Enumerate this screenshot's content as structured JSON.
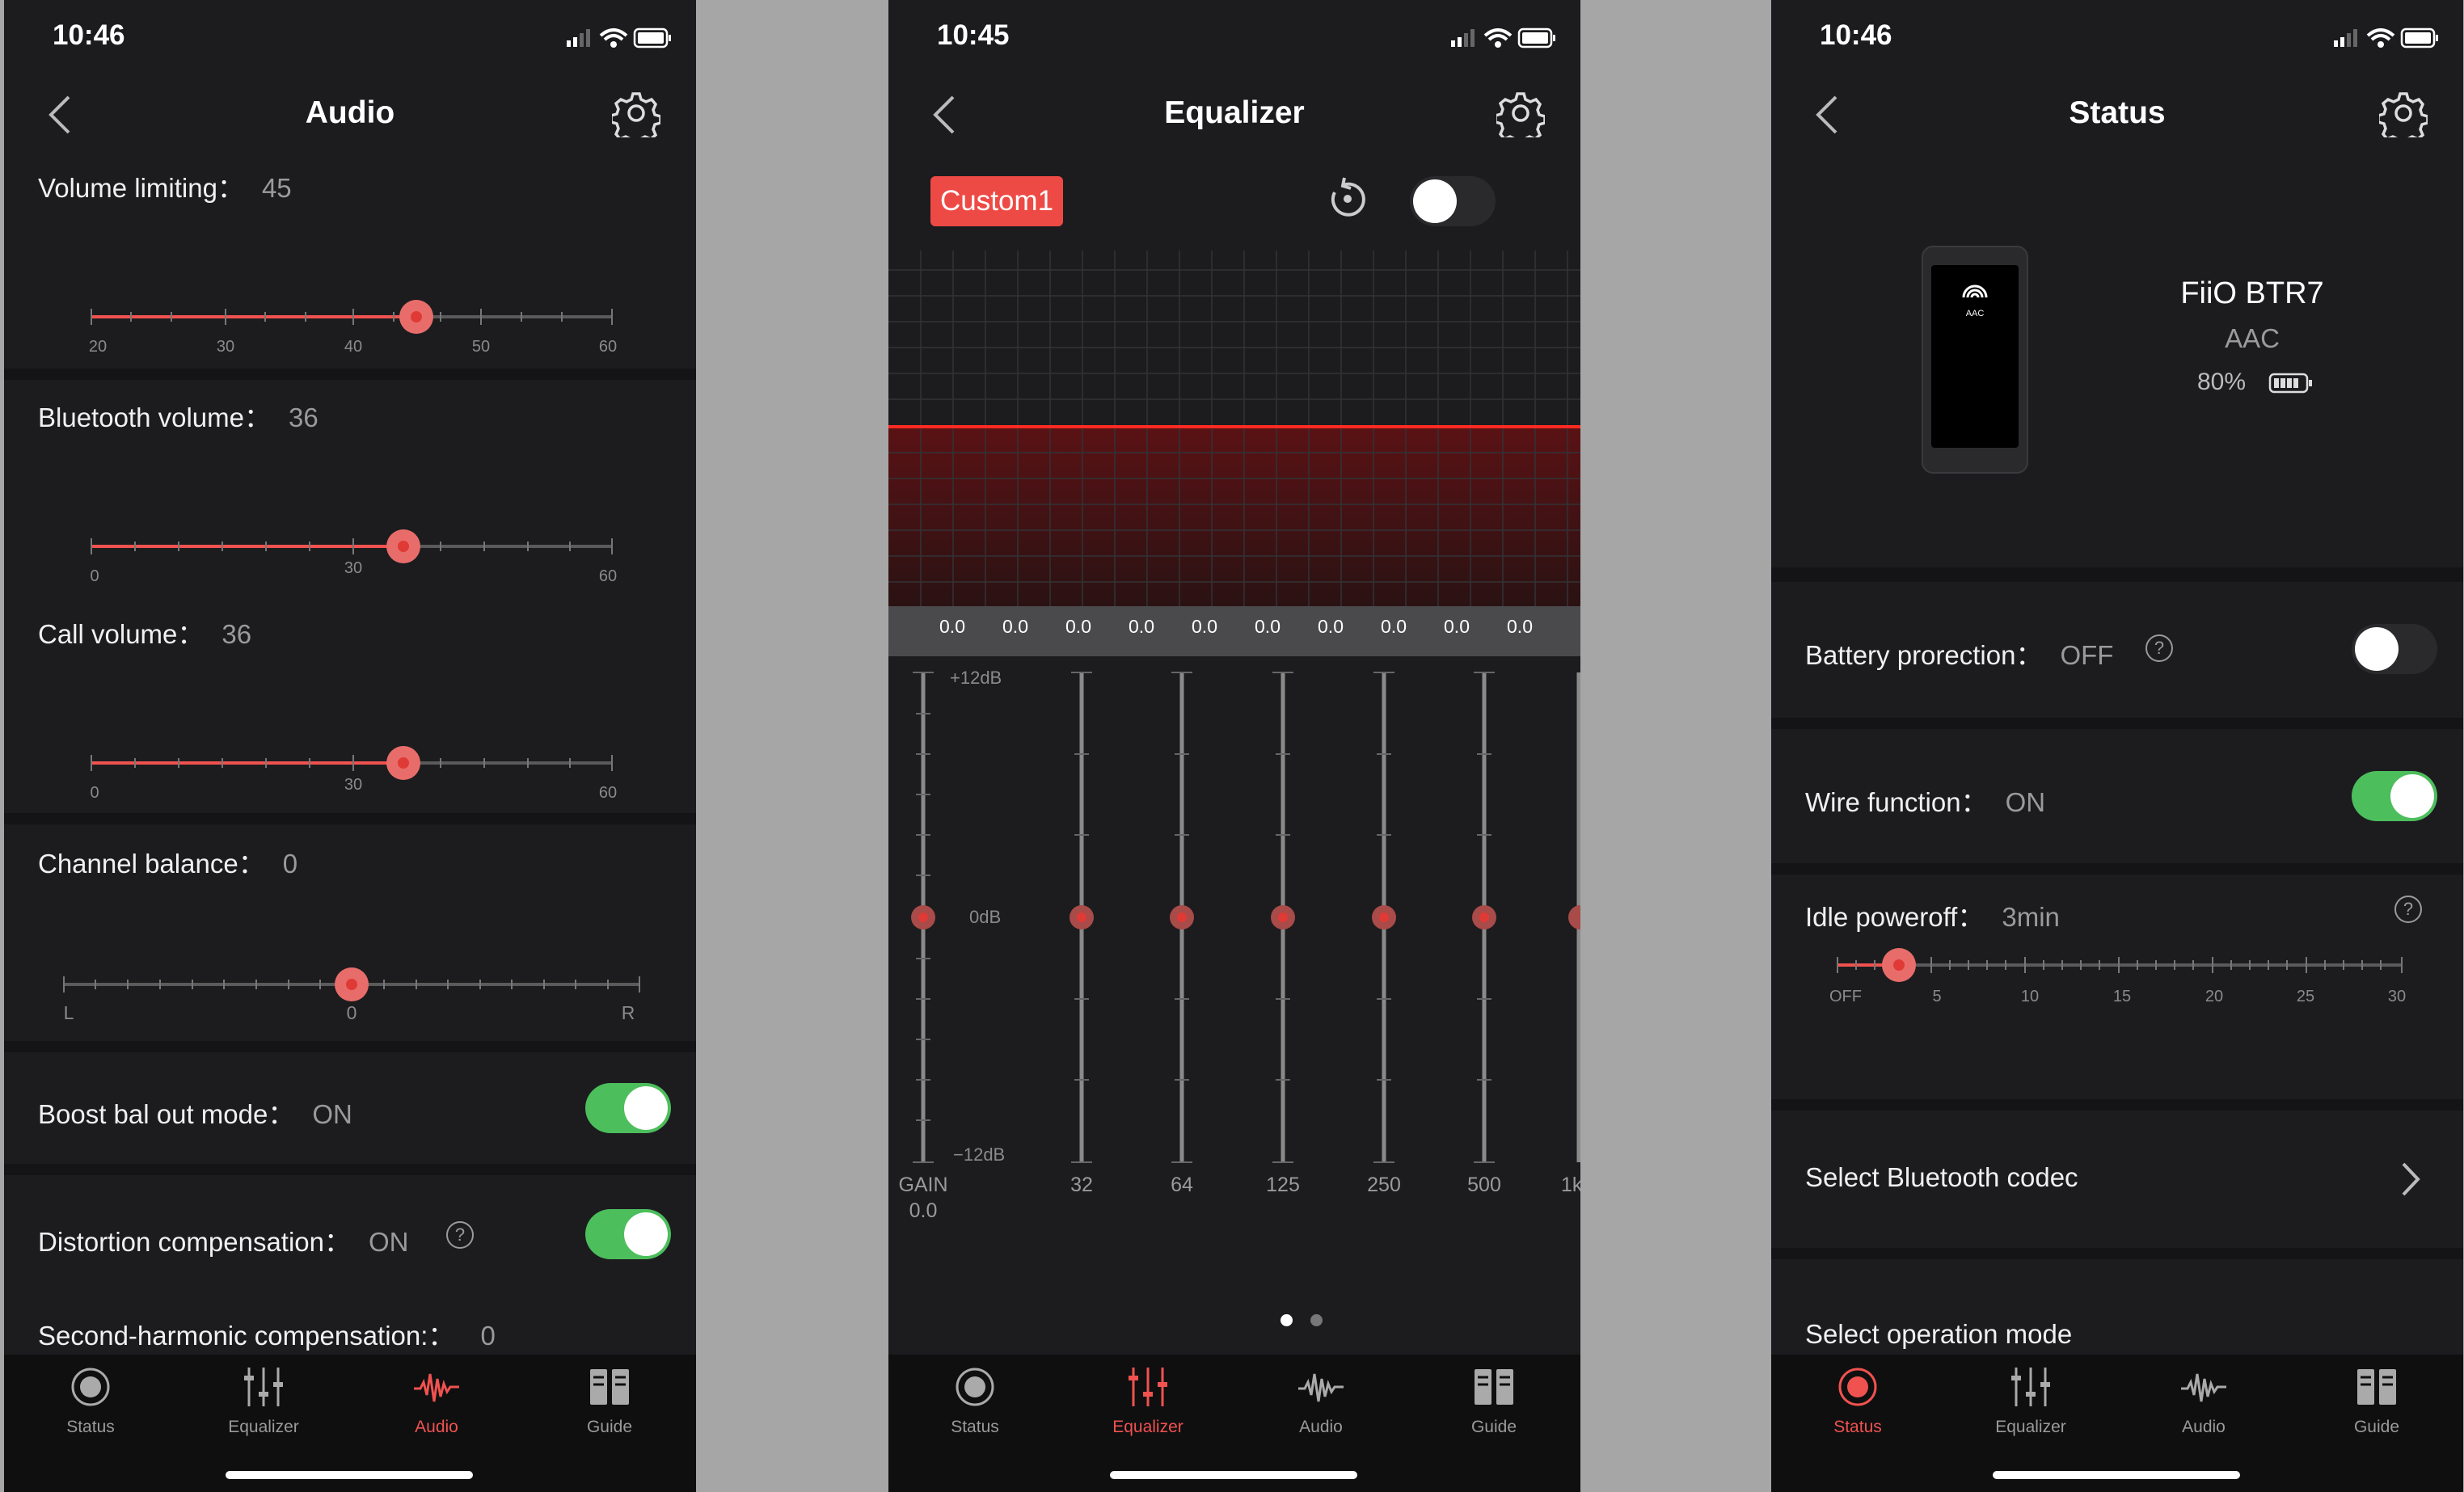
{
  "status_bar": {
    "time_left": "10:46",
    "time_middle": "10:45",
    "time_right": "10:46"
  },
  "audio_screen": {
    "title": "Audio",
    "volume_limiting": {
      "label": "Volume limiting：",
      "value": "45",
      "ticks": [
        "20",
        "30",
        "40",
        "50",
        "60"
      ],
      "min": 20,
      "max": 60,
      "current": 45
    },
    "bluetooth_volume": {
      "label": "Bluetooth volume：",
      "value": "36",
      "ticks": [
        "0",
        "30",
        "60"
      ],
      "min": 0,
      "max": 60,
      "current": 36
    },
    "call_volume": {
      "label": "Call volume：",
      "value": "36",
      "ticks": [
        "0",
        "30",
        "60"
      ],
      "min": 0,
      "max": 60,
      "current": 36
    },
    "channel_balance": {
      "label": "Channel balance：",
      "value": "0",
      "ticks": [
        "L",
        "0",
        "R"
      ],
      "current": 0
    },
    "boost_bal_out": {
      "label": "Boost bal out mode：",
      "value": "ON",
      "on": true
    },
    "distortion_compensation": {
      "label": "Distortion compensation：",
      "value": "ON",
      "help": "?",
      "on": true
    },
    "second_harmonic": {
      "label": "Second-harmonic compensation:：",
      "value": "0"
    }
  },
  "equalizer_screen": {
    "title": "Equalizer",
    "preset": "Custom1",
    "eq_enabled": false,
    "band_values": [
      "0.0",
      "0.0",
      "0.0",
      "0.0",
      "0.0",
      "0.0",
      "0.0",
      "0.0",
      "0.0",
      "0.0"
    ],
    "scale": {
      "top": "+12dB",
      "mid": "0dB",
      "bottom": "−12dB"
    },
    "gain": {
      "label": "GAIN",
      "value": "0.0"
    },
    "frequencies": [
      "32",
      "64",
      "125",
      "250",
      "500",
      "1k"
    ],
    "page_index": 0,
    "page_count": 2
  },
  "status_screen": {
    "title": "Status",
    "device": {
      "name": "FiiO BTR7",
      "codec": "AAC",
      "battery": "80%",
      "screen_logo": "AAC",
      "battery_level": 0.8
    },
    "battery_protection": {
      "label": "Battery prorection：",
      "value": "OFF",
      "help": "?",
      "on": false
    },
    "wire_function": {
      "label": "Wire function：",
      "value": "ON",
      "on": true
    },
    "idle_poweroff": {
      "label": "Idle poweroff：",
      "value": "3min",
      "help": "?",
      "ticks": [
        "OFF",
        "5",
        "10",
        "15",
        "20",
        "25",
        "30"
      ],
      "current": 3
    },
    "select_codec": {
      "label": "Select Bluetooth codec"
    },
    "select_mode": {
      "label": "Select operation mode"
    }
  },
  "tabs": {
    "status": "Status",
    "equalizer": "Equalizer",
    "audio": "Audio",
    "guide": "Guide"
  },
  "colors": {
    "accent": "#f0524f",
    "toggle_on": "#4cbe5c",
    "background": "#1c1c1f",
    "separator": "#141416"
  }
}
